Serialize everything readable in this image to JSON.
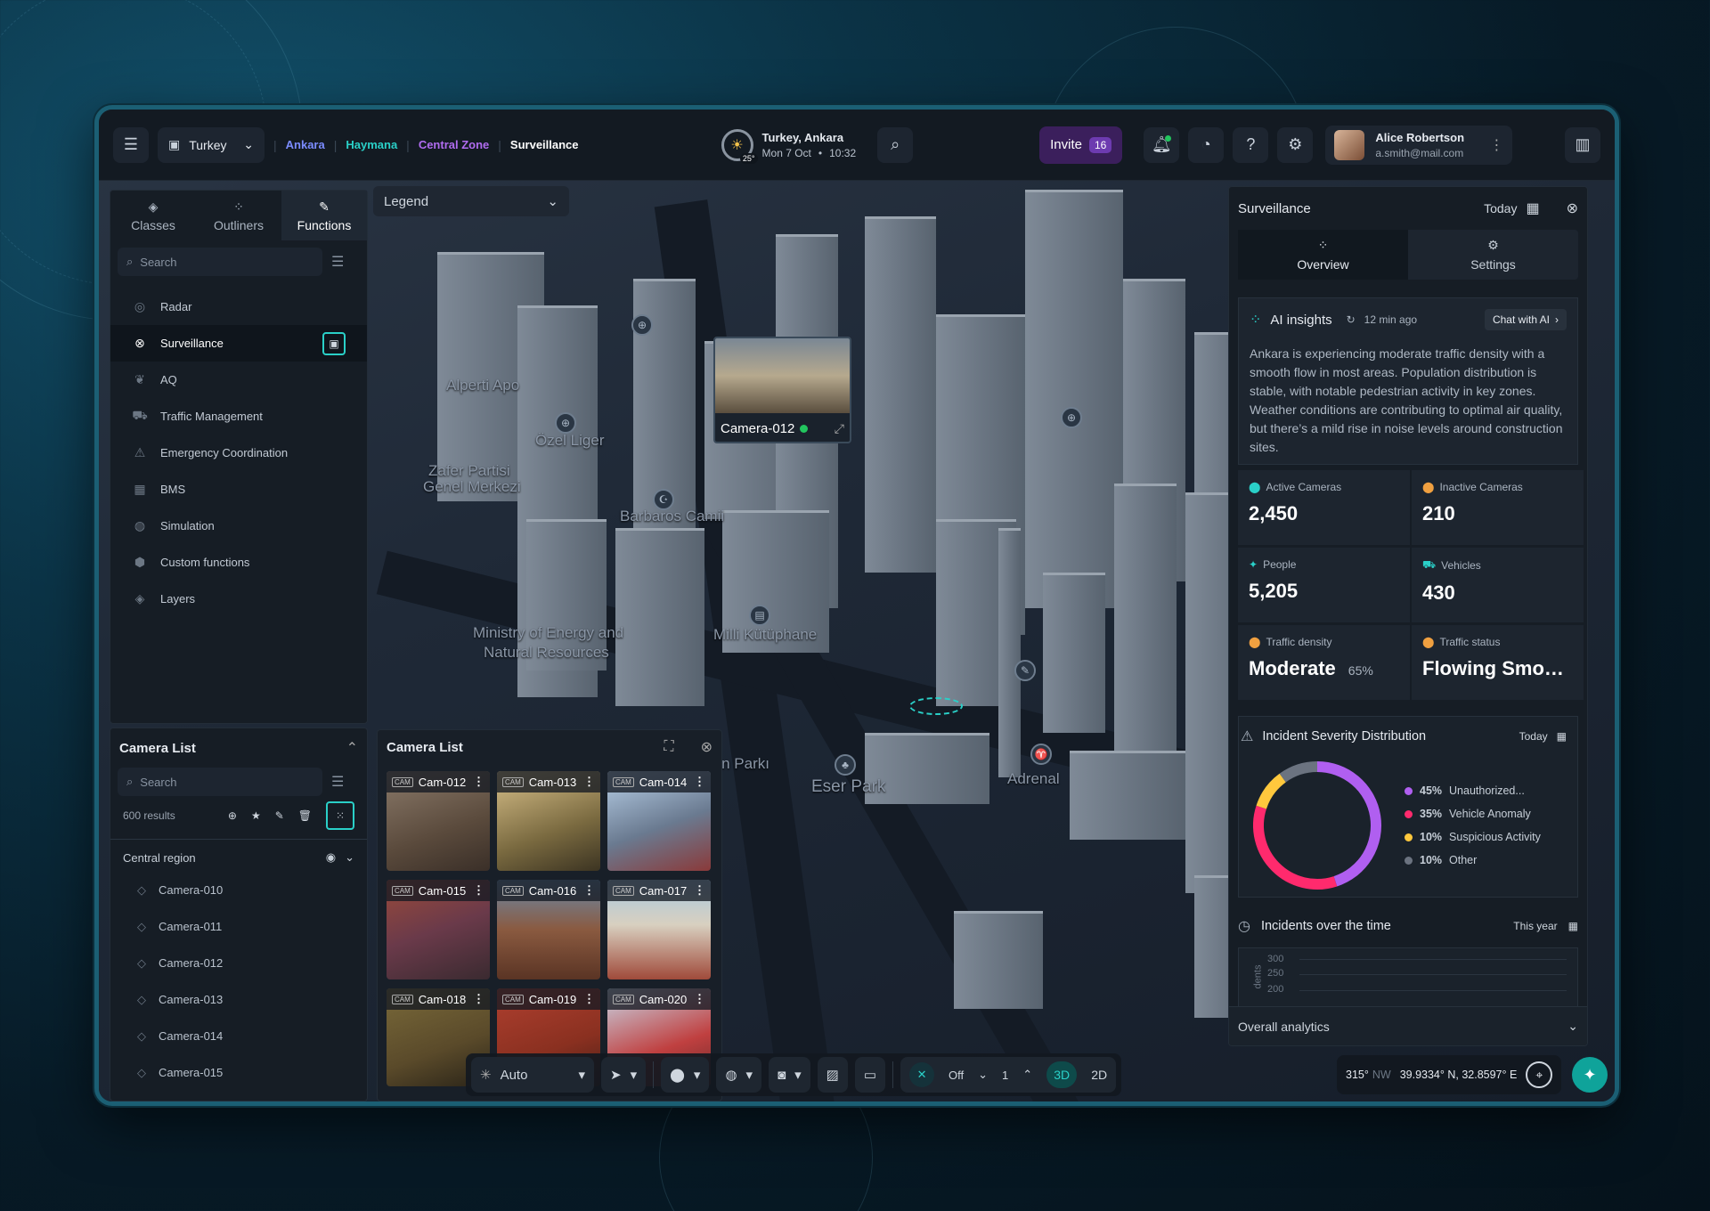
{
  "topbar": {
    "country": "Turkey",
    "breadcrumbs": [
      {
        "label": "Ankara",
        "color": "#7b8cff"
      },
      {
        "label": "Haymana",
        "color": "#2ad0c8"
      },
      {
        "label": "Central Zone",
        "color": "#b06cf0"
      },
      {
        "label": "Surveillance",
        "color": "#ffffff"
      }
    ],
    "location": "Turkey, Ankara",
    "temperature": "25°",
    "date": "Mon 7 Oct",
    "bullet": "•",
    "time": "10:32",
    "invite_label": "Invite",
    "invite_count": "16",
    "user_name": "Alice Robertson",
    "user_email": "a.smith@mail.com"
  },
  "left_panel": {
    "tabs": [
      {
        "label": "Classes",
        "icon": "layers-icon"
      },
      {
        "label": "Outliners",
        "icon": "grid-icon"
      },
      {
        "label": "Functions",
        "icon": "pen-icon"
      }
    ],
    "search_placeholder": "Search",
    "functions": [
      {
        "label": "Radar",
        "icon": "radar-icon"
      },
      {
        "label": "Surveillance",
        "icon": "close-circle-icon"
      },
      {
        "label": "AQ",
        "icon": "leaf-icon"
      },
      {
        "label": "Traffic Management",
        "icon": "car-icon"
      },
      {
        "label": "Emergency Coordination",
        "icon": "alarm-icon"
      },
      {
        "label": "BMS",
        "icon": "building-icon"
      },
      {
        "label": "Simulation",
        "icon": "sim-icon"
      },
      {
        "label": "Custom functions",
        "icon": "hex-icon"
      },
      {
        "label": "Layers",
        "icon": "layers-icon"
      }
    ]
  },
  "camera_list_panel": {
    "title": "Camera List",
    "search_placeholder": "Search",
    "results": "600 results",
    "region": "Central region",
    "cameras": [
      "Camera-010",
      "Camera-011",
      "Camera-012",
      "Camera-013",
      "Camera-014",
      "Camera-015"
    ]
  },
  "camera_grid": {
    "title": "Camera List",
    "cams": [
      "Cam-012",
      "Cam-013",
      "Cam-014",
      "Cam-015",
      "Cam-016",
      "Cam-017",
      "Cam-018",
      "Cam-019",
      "Cam-020"
    ]
  },
  "map": {
    "legend": "Legend",
    "popup_camera": "Camera-012",
    "labels": [
      "Ministry of Energy and",
      "Natural Resources",
      "Milli Kütüphane",
      "Eser Park",
      "Barbaros Camii",
      "Zafer Partisi",
      "Genel Merkezi",
      "Adrenal",
      "Gökken Parkı",
      "Özel Liger",
      "Alperti Apo"
    ]
  },
  "toolbar": {
    "mode": "Auto",
    "off": "Off",
    "count": "1",
    "view_3d": "3D",
    "view_2d": "2D",
    "heading": "315°",
    "heading_dir": "NW",
    "coords": "39.9334° N, 32.8597° E"
  },
  "right_panel": {
    "title": "Surveillance",
    "period": "Today",
    "tabs": [
      "Overview",
      "Settings"
    ],
    "ai_title": "AI insights",
    "ai_time": "12 min ago",
    "chat_label": "Chat with AI",
    "ai_text": "Ankara is experiencing moderate traffic density with a smooth flow in most areas. Population distribution is stable, with notable pedestrian activity in key zones. Weather conditions are contributing to optimal air quality, but there’s a mild rise in noise levels around construction sites.",
    "stats": [
      {
        "label": "Active Cameras",
        "value": "2,450",
        "color": "#2ad0c8"
      },
      {
        "label": "Inactive Cameras",
        "value": "210",
        "color": "#f0a040"
      },
      {
        "label": "People",
        "value": "5,205",
        "color": "#2ad0c8"
      },
      {
        "label": "Vehicles",
        "value": "430",
        "color": "#2ad0c8"
      },
      {
        "label": "Traffic density",
        "value": "Moderate",
        "extra": "65%",
        "color": "#f0a040"
      },
      {
        "label": "Traffic status",
        "value": "Flowing Smoot...",
        "color": "#f0a040"
      }
    ],
    "incident_title": "Incident Severity Distribution",
    "incident_period": "Today",
    "incidents_over_title": "Incidents over the time",
    "incidents_over_period": "This year",
    "overall": "Overall analytics",
    "y_ticks": [
      "300",
      "250",
      "200"
    ],
    "y_label": "dents"
  },
  "chart_data": {
    "type": "pie",
    "title": "Incident Severity Distribution",
    "categories": [
      "Unauthorized...",
      "Vehicle Anomaly",
      "Suspicious Activity",
      "Other"
    ],
    "values": [
      45,
      35,
      10,
      10
    ],
    "labels": [
      "45%",
      "35%",
      "10%",
      "10%"
    ],
    "colors": [
      "#b05ff0",
      "#ff2a6d",
      "#ffc83d",
      "#6b7380"
    ]
  }
}
